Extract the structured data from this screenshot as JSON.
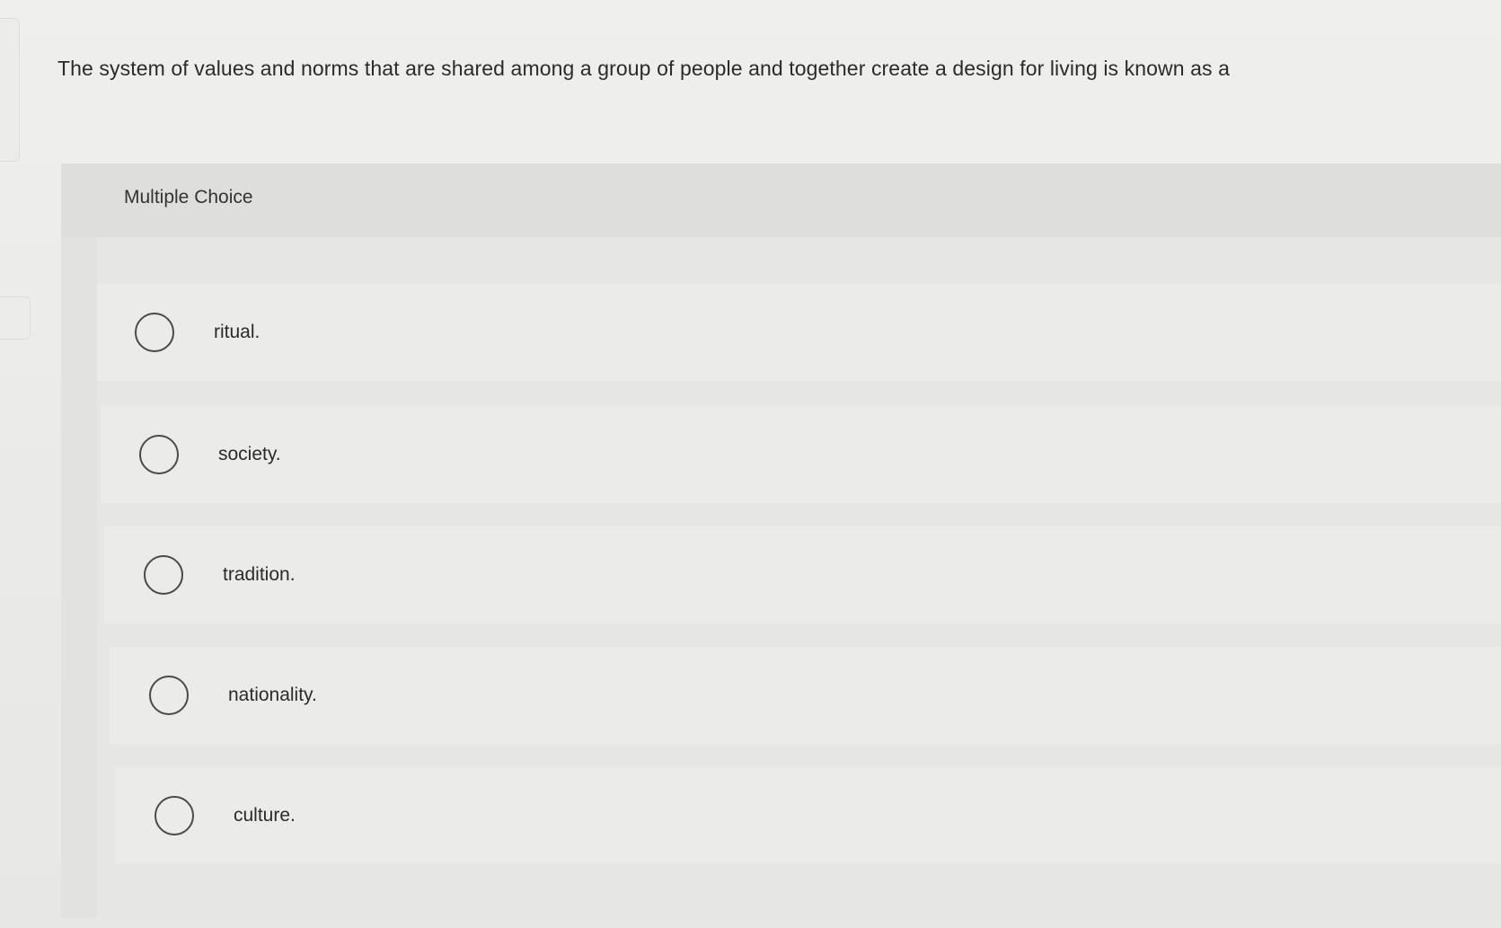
{
  "question": {
    "text": "The system of values and norms that are shared among a group of people and together create a design for living is known as a"
  },
  "multiple_choice": {
    "label": "Multiple Choice",
    "options": [
      {
        "label": "ritual.",
        "selected": false
      },
      {
        "label": "society.",
        "selected": false
      },
      {
        "label": "tradition.",
        "selected": false
      },
      {
        "label": "nationality.",
        "selected": false
      },
      {
        "label": "culture.",
        "selected": false
      }
    ]
  }
}
